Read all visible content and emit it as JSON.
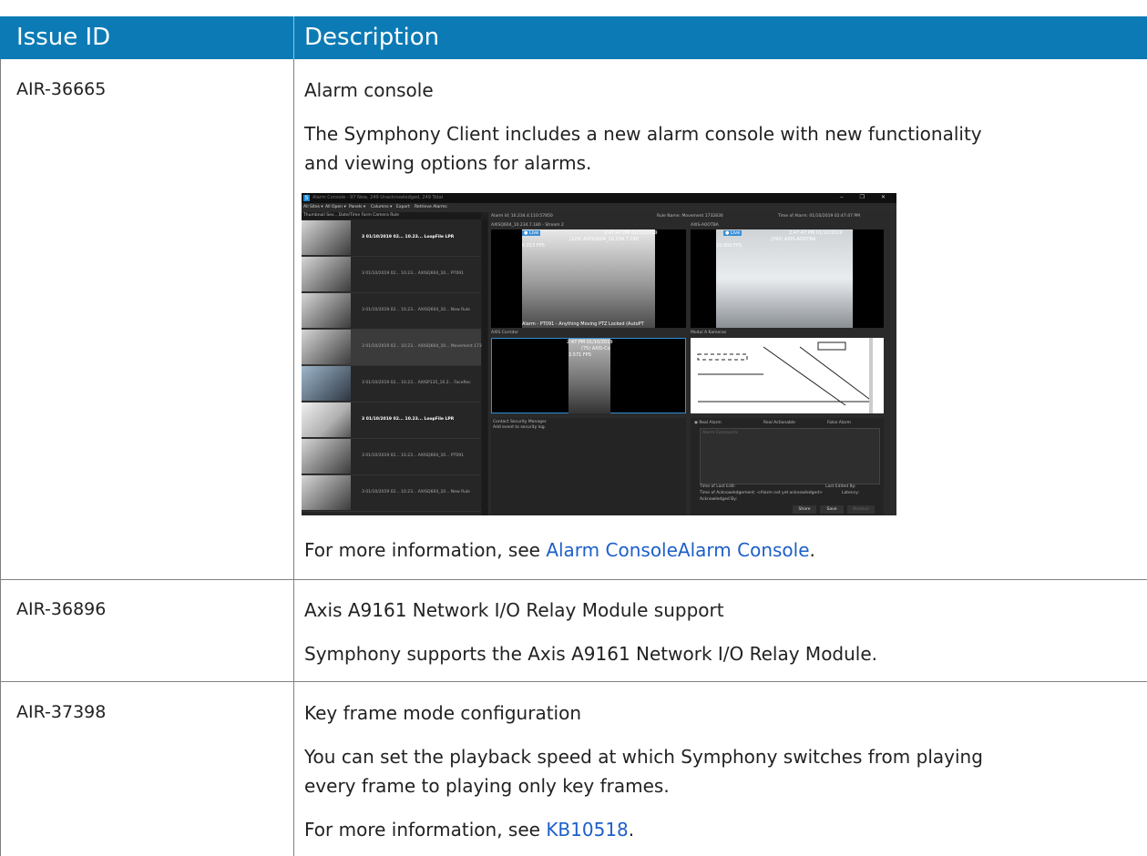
{
  "table": {
    "headers": {
      "issue_id": "Issue ID",
      "description": "Description"
    },
    "rows": [
      {
        "id": "AIR-36665",
        "title": "Alarm console",
        "body_line1": "The Symphony Client includes a new alarm console with new functionality",
        "body_line2": "and viewing options for alarms.",
        "more_prefix": "For more information, see ",
        "link_text": "Alarm ConsoleAlarm Console",
        "more_suffix": "."
      },
      {
        "id": "AIR-36896",
        "title": "Axis A9161 Network I/O Relay Module support",
        "body_line1": "Symphony supports the Axis A9161 Network I/O Relay Module."
      },
      {
        "id": "AIR-37398",
        "title": "Key frame mode configuration",
        "body_line1": "You can set the playback speed at which Symphony switches from playing",
        "body_line2": "every frame to playing only key frames.",
        "more_prefix": "For more information, see ",
        "link_text": "KB10518",
        "more_suffix": "."
      }
    ]
  },
  "screenshot": {
    "title": "Alarm Console - 97 New, 249 Unacknowledged, 249 Total",
    "menu": [
      "All Sites ▾",
      "All Open ▾",
      "Panels ▾",
      "Columns ▾",
      "Export",
      "Retrieve Alarms"
    ],
    "list_header": "Thumbnail   Sev... Date/Time      Farm    Camera        Rule",
    "list_rows": [
      "3  01/10/2019 02...  10.23...  LoopFile        LPR",
      "3  01/10/2019 02...  10.23...  AXISQ604_10...  PT091",
      "3  01/10/2019 02...  10.23...  AXISQ604_10...  New Rule",
      "3  01/10/2019 02...  10.23...  AXISQ604_10...  Movement 173...",
      "3  01/10/2019 02...  10.23...  AXISP135_10.2...  FaceRec",
      "3  01/10/2019 02...  10.23...  LoopFile        LPR",
      "3  01/10/2019 02...  10.23...  AXISQ604_10...  PT091",
      "3  01/10/2019 02...  10.23...  AXISQ604_10...  New Rule"
    ],
    "alarm_header_left": "Alarm Id:  10.234.4.110:57850",
    "alarm_header_mid": "Rule Name:  Movement 1732836",
    "alarm_header_right": "Time of Alarm:  01/10/2019 02:47:47 PM",
    "pane1_label": "AXISQ604_10.234.7.180 - Stream 2",
    "pane2_label": "AXIS-AOOTBA",
    "pane3_label": "AXIS Corridor",
    "pane4_label": "Modul A Kameras",
    "osd1_time": "2:47:47 PM 01/10/2019",
    "osd1_name": "(129) AXISQ604_10.234.7.180",
    "osd1_fps": "6.013 FPS",
    "osd1_bottom": "Alarm - PT091 - Anything Moving    PTZ Locked (AutoPT",
    "osd2_time": "2:47:47 PM 01/10/2019",
    "osd2_name": "(290) AXIS-AOOTBA",
    "osd2_fps": "10.000 FPS",
    "osd3_time": "2:47 PM 01/10/2019",
    "osd3_name": "(75) AXIS-Co",
    "osd3_fps": "3.571 FPS",
    "notes_line1": "Contact Security Manager.",
    "notes_line2": "Add event to security log.",
    "radio_real": "Real Alarm",
    "radio_actionable": "Real Actionable",
    "radio_false": "False Alarm",
    "comments_placeholder": "Alarm Comments",
    "time_last_edit": "Time of Last Edit:",
    "last_edited_by": "Last Edited By:",
    "time_ack": "Time of Acknowledgement:   <Alarm not yet acknowledged>",
    "latency": "Latency:",
    "ack_by": "Acknowledged By:",
    "btn_share": "Share",
    "btn_save": "Save",
    "btn_resolve": "Resolve"
  }
}
